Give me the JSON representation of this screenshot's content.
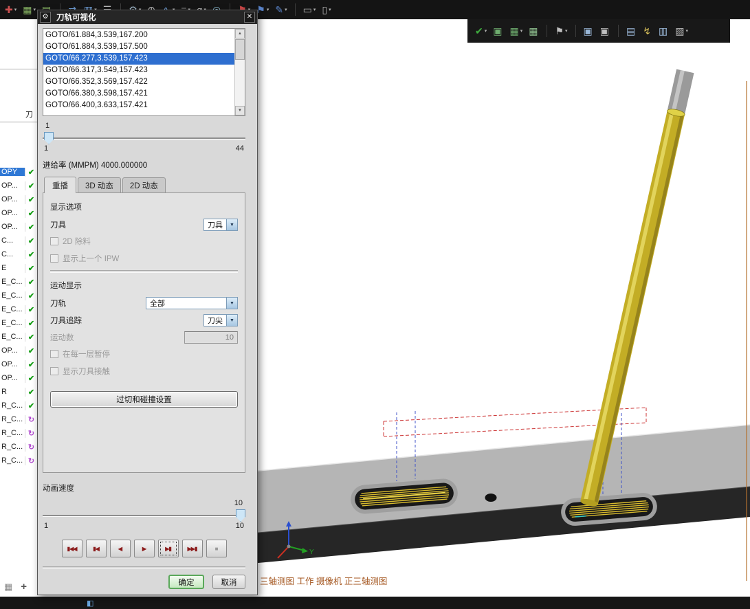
{
  "icons": {
    "gear": "⚙",
    "close": "✕",
    "dropdown": "▼",
    "scroll_up": "▲",
    "scroll_down": "▼",
    "grid": "▦",
    "plus": "+",
    "status": "◧"
  },
  "toolbar": {
    "row1": [
      {
        "glyph": "✚",
        "color": "#c95050",
        "drop": "▾"
      },
      {
        "glyph": "▦",
        "color": "#84b061",
        "drop": "▾"
      },
      {
        "glyph": "▤",
        "color": "#84b061"
      },
      {
        "glyph": "",
        "cls": "sep"
      },
      {
        "glyph": "⇄",
        "color": "#6f9fd8"
      },
      {
        "glyph": "▥",
        "color": "#6f9fd8",
        "drop": "▾"
      },
      {
        "glyph": "☰",
        "color": "#b8b8b8"
      },
      {
        "glyph": "",
        "cls": "sep"
      },
      {
        "glyph": "⚙",
        "color": "#9fb6c8",
        "drop": "▾"
      },
      {
        "glyph": "⊕",
        "color": "#c8c8c8"
      },
      {
        "glyph": "∿",
        "color": "#6f9fd8",
        "drop": "▾"
      },
      {
        "glyph": "≡",
        "color": "#8a8a8a",
        "drop": "▾"
      },
      {
        "glyph": "⌀",
        "color": "#c8c8c8",
        "drop": "▾"
      },
      {
        "glyph": "◎",
        "color": "#9ad0e8"
      },
      {
        "glyph": "",
        "cls": "sep"
      },
      {
        "glyph": "⚑",
        "color": "#d04848",
        "drop": "▾"
      },
      {
        "glyph": "⚑",
        "color": "#5a85cc",
        "drop": "▾"
      },
      {
        "glyph": "✎",
        "color": "#5a85cc",
        "drop": "▾"
      },
      {
        "glyph": "",
        "cls": "sep"
      },
      {
        "glyph": "▭",
        "color": "#b0b0b0",
        "drop": "▾"
      },
      {
        "glyph": "▯",
        "color": "#b0b0b0",
        "drop": "▾"
      }
    ],
    "row2": [
      {
        "glyph": "✔",
        "color": "#3fae3f",
        "drop": "▾"
      },
      {
        "glyph": "▣",
        "color": "#6fae6f"
      },
      {
        "glyph": "▦",
        "color": "#6fae6f",
        "drop": "▾"
      },
      {
        "glyph": "▦",
        "color": "#8fc08f"
      },
      {
        "glyph": "",
        "cls": "sep"
      },
      {
        "glyph": "⚑",
        "color": "#c0c0c0",
        "drop": "▾"
      },
      {
        "glyph": "",
        "cls": "sep"
      },
      {
        "glyph": "▣",
        "color": "#9ab8d8"
      },
      {
        "glyph": "▣",
        "color": "#c0c0c0"
      },
      {
        "glyph": "",
        "cls": "sep"
      },
      {
        "glyph": "▤",
        "color": "#9ab8d8"
      },
      {
        "glyph": "↯",
        "color": "#d8c05a"
      },
      {
        "glyph": "▥",
        "color": "#9ab8d8"
      },
      {
        "glyph": "▨",
        "color": "#c0c0c0",
        "drop": "▾"
      }
    ]
  },
  "left_panel": {
    "header": "刀",
    "rows": [
      {
        "label": "OPY",
        "mark": "✔",
        "cls": "selected mark-check"
      },
      {
        "label": "OP...",
        "mark": "✔",
        "cls": "mark-check"
      },
      {
        "label": "OP...",
        "mark": "✔",
        "cls": "mark-check"
      },
      {
        "label": "OP...",
        "mark": "✔",
        "cls": "mark-check"
      },
      {
        "label": "OP...",
        "mark": "✔",
        "cls": "mark-check"
      },
      {
        "label": "C...",
        "mark": "✔",
        "cls": "mark-check"
      },
      {
        "label": "C...",
        "mark": "✔",
        "cls": "mark-check"
      },
      {
        "label": "E",
        "mark": "✔",
        "cls": "mark-check"
      },
      {
        "label": "E_C...",
        "mark": "✔",
        "cls": "mark-check"
      },
      {
        "label": "E_C...",
        "mark": "✔",
        "cls": "mark-check"
      },
      {
        "label": "E_C...",
        "mark": "✔",
        "cls": "mark-check"
      },
      {
        "label": "E_C...",
        "mark": "✔",
        "cls": "mark-check"
      },
      {
        "label": "E_C...",
        "mark": "✔",
        "cls": "mark-check"
      },
      {
        "label": "OP...",
        "mark": "✔",
        "cls": "mark-check"
      },
      {
        "label": "OP...",
        "mark": "✔",
        "cls": "mark-check"
      },
      {
        "label": "OP...",
        "mark": "✔",
        "cls": "mark-check"
      },
      {
        "label": "R",
        "mark": "✔",
        "cls": "mark-check"
      },
      {
        "label": "R_C...",
        "mark": "✔",
        "cls": "mark-check"
      },
      {
        "label": "R_C...",
        "mark": "↻",
        "cls": "mark-purple"
      },
      {
        "label": "R_C...",
        "mark": "↻",
        "cls": "mark-purple"
      },
      {
        "label": "R_C...",
        "mark": "↻",
        "cls": "mark-purple"
      },
      {
        "label": "R_C...",
        "mark": "↻",
        "cls": "mark-purple"
      }
    ]
  },
  "dialog": {
    "title": "刀轨可视化",
    "goto_lines": [
      {
        "text": "GOTO/61.884,3.539,167.200"
      },
      {
        "text": "GOTO/61.884,3.539,157.500"
      },
      {
        "text": "GOTO/66.277,3.539,157.423",
        "cls": "selected"
      },
      {
        "text": "GOTO/66.317,3.549,157.423"
      },
      {
        "text": "GOTO/66.352,3.569,157.422"
      },
      {
        "text": "GOTO/66.380,3.598,157.421"
      },
      {
        "text": "GOTO/66.400,3.633,157.421"
      }
    ],
    "progress": {
      "current": "1",
      "min": "1",
      "max": "44"
    },
    "feedrate_label": "进给率 (MMPM) 4000.000000",
    "tabs": [
      {
        "label": "重播",
        "cls": "active"
      },
      {
        "label": "3D 动态"
      },
      {
        "label": "2D 动态"
      }
    ],
    "replay": {
      "display_options_label": "显示选项",
      "tool_label": "刀具",
      "tool_value": "刀具",
      "checkbox_2d_label": "2D 除料",
      "checkbox_ipw_label": "显示上一个 IPW",
      "motion_display_label": "运动显示",
      "toolpath_label": "刀轨",
      "toolpath_value": "全部",
      "tool_track_label": "刀具追踪",
      "tool_track_value": "刀尖",
      "motion_count_label": "运动数",
      "motion_count_value": "10",
      "checkbox_pause_label": "在每一层暂停",
      "checkbox_contact_label": "显示刀具接触",
      "collision_button_label": "过切和碰撞设置"
    },
    "animation": {
      "label": "动画速度",
      "value": "10",
      "min": "1",
      "max": "10"
    },
    "playback": [
      {
        "glyph": "▮◀◀"
      },
      {
        "glyph": "▮◀"
      },
      {
        "glyph": "◀"
      },
      {
        "glyph": "▶"
      },
      {
        "glyph": "▶▮",
        "cls": "focused"
      },
      {
        "glyph": "▶▶▮"
      },
      {
        "glyph": "■",
        "cls": "disabled"
      }
    ],
    "ok_label": "确定",
    "cancel_label": "取消"
  },
  "viewport": {
    "view_label": "三轴测图 工作 摄像机 正三轴测图",
    "axis_y_label": "Y"
  }
}
